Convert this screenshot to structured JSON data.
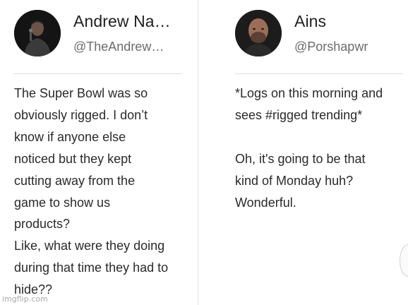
{
  "left_tweet": {
    "author_name": "Andrew Na…",
    "handle": "@TheAndrew…",
    "body_lines": [
      "The Super Bowl was so",
      "obviously rigged. I don’t",
      "know if anyone else",
      "noticed but they kept",
      "cutting away from the",
      "game to show us",
      "products?",
      "Like, what were they doing",
      "during that time they had to",
      "hide??"
    ]
  },
  "right_tweet": {
    "author_name": "Ains",
    "handle": "@Porshapwr",
    "body_lines": [
      "*Logs on this morning and",
      "sees #rigged trending*",
      "",
      "Oh, it's going to be that",
      "kind of Monday huh?",
      "Wonderful."
    ]
  },
  "watermark": "imgflip.com"
}
